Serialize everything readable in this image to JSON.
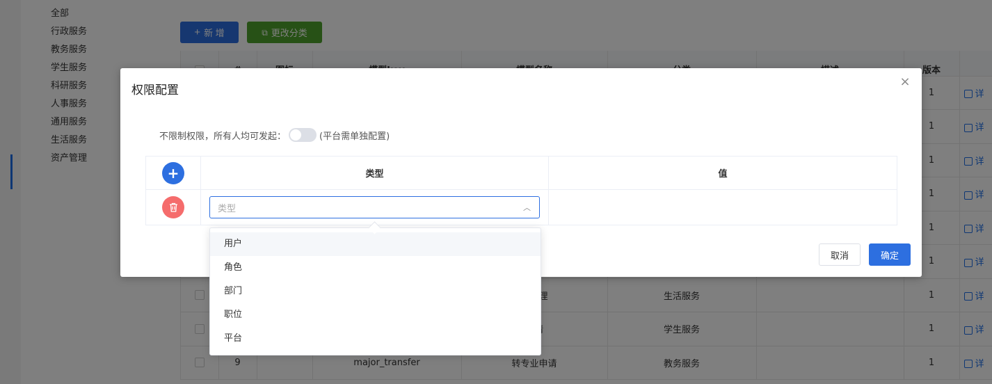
{
  "sidebar": {
    "categories": [
      "全部",
      "行政服务",
      "教务服务",
      "学生服务",
      "科研服务",
      "人事服务",
      "通用服务",
      "生活服务",
      "资产管理"
    ]
  },
  "toolbar": {
    "add_label": "新 增",
    "change_category_label": "更改分类"
  },
  "table": {
    "headers": [
      "",
      "#",
      "图标",
      "模型key",
      "模型名称",
      "分类",
      "描述",
      "版本",
      ""
    ],
    "rows": [
      {
        "index": "",
        "key": "",
        "name": "",
        "category": "",
        "version": "1",
        "action": "详"
      },
      {
        "index": "",
        "key": "",
        "name": "",
        "category": "",
        "version": "1",
        "action": "详"
      },
      {
        "index": "",
        "key": "",
        "name": "",
        "category": "",
        "version": "1",
        "action": "详"
      },
      {
        "index": "",
        "key": "",
        "name": "",
        "category": "",
        "version": "1",
        "action": "详"
      },
      {
        "index": "",
        "key": "",
        "name": "",
        "category": "",
        "version": "1",
        "action": "详"
      },
      {
        "index": "",
        "key": "",
        "name": "",
        "category": "",
        "version": "1",
        "action": "详"
      },
      {
        "index": "",
        "key": "",
        "name": "证办理",
        "category": "生活服务",
        "version": "1",
        "action": "详"
      },
      {
        "index": "",
        "key": "",
        "name": "申请",
        "category": "学生服务",
        "version": "1",
        "action": "详"
      },
      {
        "index": "9",
        "key": "major_transfer",
        "name": "转专业申请",
        "category": "教务服务",
        "version": "1",
        "action": "详"
      }
    ]
  },
  "dialog": {
    "title": "权限配置",
    "switch_label": "不限制权限，所有人均可发起：",
    "switch_note": "(平台需单独配置)",
    "switch_on": false,
    "col_type": "类型",
    "col_value": "值",
    "select_placeholder": "类型",
    "cancel_label": "取消",
    "ok_label": "确定"
  },
  "dropdown": {
    "options": [
      "用户",
      "角色",
      "部门",
      "职位",
      "平台"
    ],
    "hovered_index": 0
  },
  "colors": {
    "primary": "#2d6fe0",
    "success": "#4fa32c",
    "danger": "#f56c6c"
  }
}
